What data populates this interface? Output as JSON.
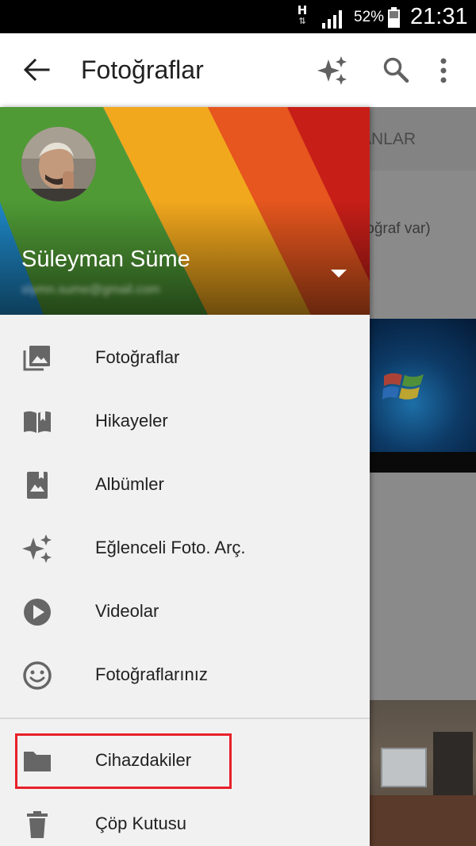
{
  "status_bar": {
    "network_type": "H",
    "battery_percent": "52%",
    "time": "21:31"
  },
  "app_bar": {
    "title": "Fotoğraflar"
  },
  "background": {
    "tab_label_partial": "ANLAR",
    "count_partial": "toğraf var)"
  },
  "drawer": {
    "account": {
      "name": "Süleyman Süme",
      "email": "slymn.sume@gmail.com"
    },
    "menu_items": [
      {
        "label": "Fotoğraflar",
        "icon": "photos-icon"
      },
      {
        "label": "Hikayeler",
        "icon": "stories-icon"
      },
      {
        "label": "Albümler",
        "icon": "albums-icon"
      },
      {
        "label": "Eğlenceli Foto. Arç.",
        "icon": "assistant-sparkle-icon"
      },
      {
        "label": "Videolar",
        "icon": "play-circle-icon"
      },
      {
        "label": "Fotoğraflarınız",
        "icon": "smiley-face-icon"
      }
    ],
    "secondary_items": [
      {
        "label": "Cihazdakiler",
        "icon": "folder-icon",
        "highlighted": true
      },
      {
        "label": "Çöp Kutusu",
        "icon": "trash-icon"
      }
    ]
  },
  "colors": {
    "highlight": "#e8202a",
    "drawer_background": "#f1f1f1",
    "icon": "#666666"
  }
}
